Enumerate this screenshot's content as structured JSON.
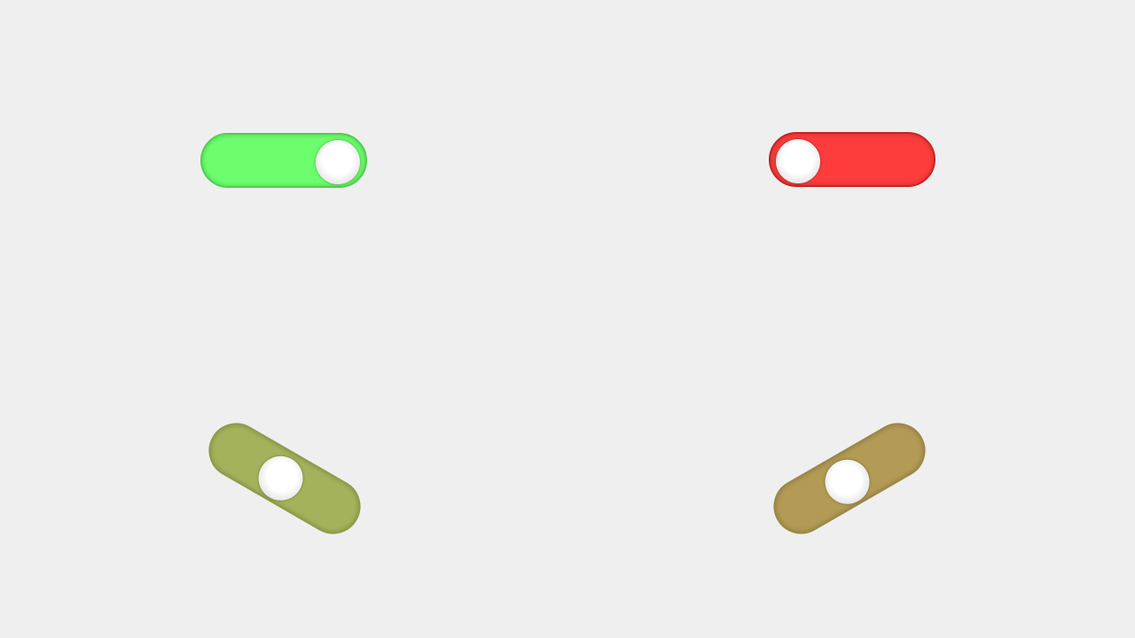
{
  "toggles": [
    {
      "id": "t1",
      "state": "on",
      "color": "#6cfe6c",
      "border": "#4fcf4f"
    },
    {
      "id": "t2",
      "state": "off",
      "color": "#fe3c3c",
      "border": "#c42525"
    },
    {
      "id": "t3",
      "state": "intermediate",
      "color": "#a4b35b",
      "border": "#8d9b4a"
    },
    {
      "id": "t4",
      "state": "intermediate",
      "color": "#b39b55",
      "border": "#9d8646"
    }
  ]
}
